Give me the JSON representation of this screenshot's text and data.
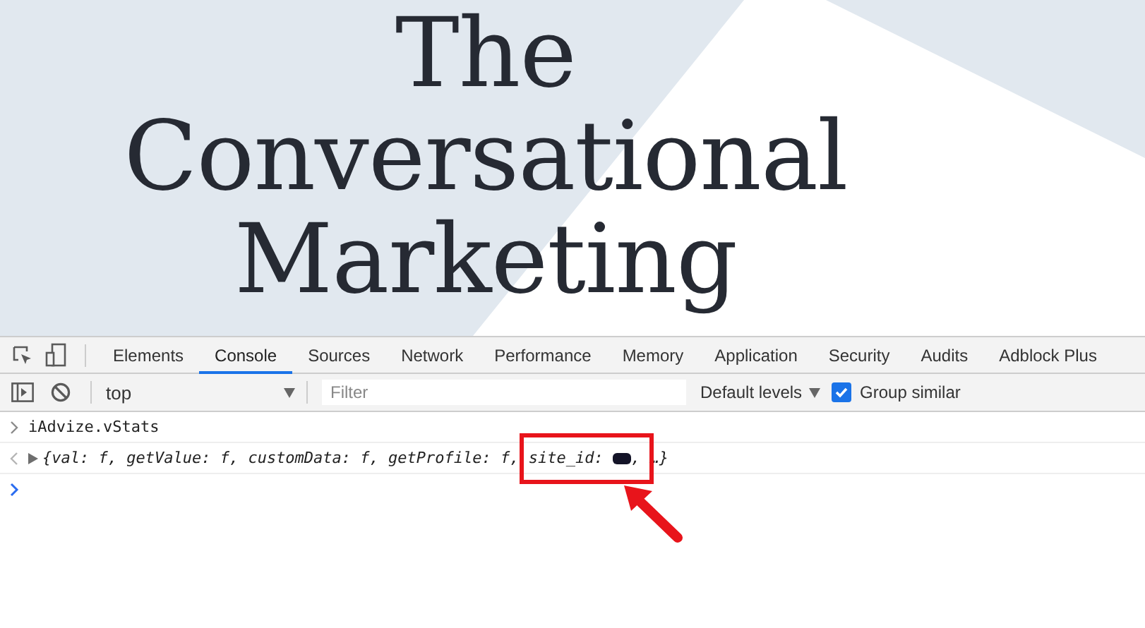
{
  "page": {
    "heading_lines": [
      "The",
      "Conversational",
      "Marketing"
    ]
  },
  "devtools": {
    "tabs": [
      {
        "label": "Elements",
        "selected": false
      },
      {
        "label": "Console",
        "selected": true
      },
      {
        "label": "Sources",
        "selected": false
      },
      {
        "label": "Network",
        "selected": false
      },
      {
        "label": "Performance",
        "selected": false
      },
      {
        "label": "Memory",
        "selected": false
      },
      {
        "label": "Application",
        "selected": false
      },
      {
        "label": "Security",
        "selected": false
      },
      {
        "label": "Audits",
        "selected": false
      },
      {
        "label": "Adblock Plus",
        "selected": false
      }
    ],
    "toolbar": {
      "context": "top",
      "filter_placeholder": "Filter",
      "levels": "Default levels",
      "group_similar": {
        "label": "Group similar",
        "checked": true
      }
    },
    "console": [
      {
        "kind": "input",
        "text": "iAdvize.vStats"
      },
      {
        "kind": "output",
        "text": "{val: f, getValue: f, customData: f, getProfile: f, site_id: ",
        "redacted": true,
        "tail": ", …}",
        "highlighted": true
      }
    ]
  }
}
